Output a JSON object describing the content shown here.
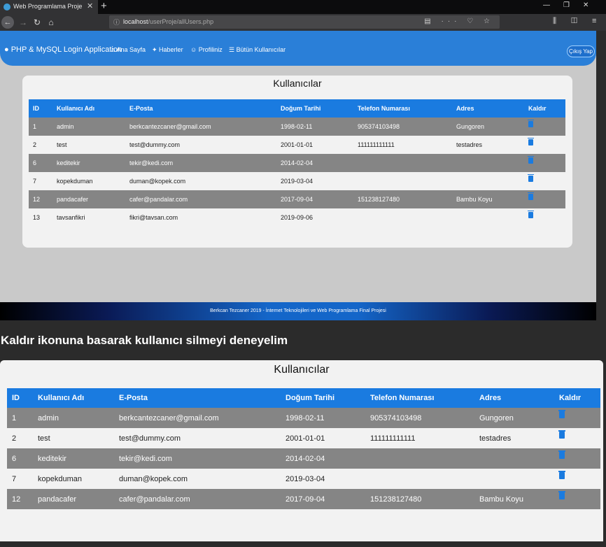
{
  "browser": {
    "tab_title": "Web Programlama Proje",
    "url_host": "localhost",
    "url_path": "/userProje/allUsers.php"
  },
  "app": {
    "brand": "PHP & MySQL Login Application",
    "nav": [
      "Ana Sayfa",
      "Haberler",
      "Profiliniz",
      "Bütün Kullanıcılar"
    ],
    "logout": "Çıkış Yap"
  },
  "table": {
    "title": "Kullanıcılar",
    "headers": [
      "ID",
      "Kullanıcı Adı",
      "E-Posta",
      "Doğum Tarihi",
      "Telefon Numarası",
      "Adres",
      "Kaldır"
    ],
    "rows": [
      [
        "1",
        "admin",
        "berkcantezcaner@gmail.com",
        "1998-02-11",
        "905374103498",
        "Gungoren"
      ],
      [
        "2",
        "test",
        "test@dummy.com",
        "2001-01-01",
        "111111111111",
        "testadres"
      ],
      [
        "6",
        "keditekir",
        "tekir@kedi.com",
        "2014-02-04",
        "",
        ""
      ],
      [
        "7",
        "kopekduman",
        "duman@kopek.com",
        "2019-03-04",
        "",
        ""
      ],
      [
        "12",
        "pandacafer",
        "cafer@pandalar.com",
        "2017-09-04",
        "151238127480",
        "Bambu Koyu"
      ],
      [
        "13",
        "tavsanfikri",
        "fikri@tavsan.com",
        "2019-09-06",
        "",
        ""
      ]
    ]
  },
  "footer": "Berkcan Tezcaner 2019 - İnternet Teknolojileri ve Web Programlama Final Projesi",
  "caption": "Kaldır ikonuna basarak kullanıcı silmeyi deneyelim",
  "zoom_row_count": 5,
  "colors": {
    "accent": "#1a7be0",
    "row_dark": "#858585",
    "nav": "#2a7fd8"
  }
}
